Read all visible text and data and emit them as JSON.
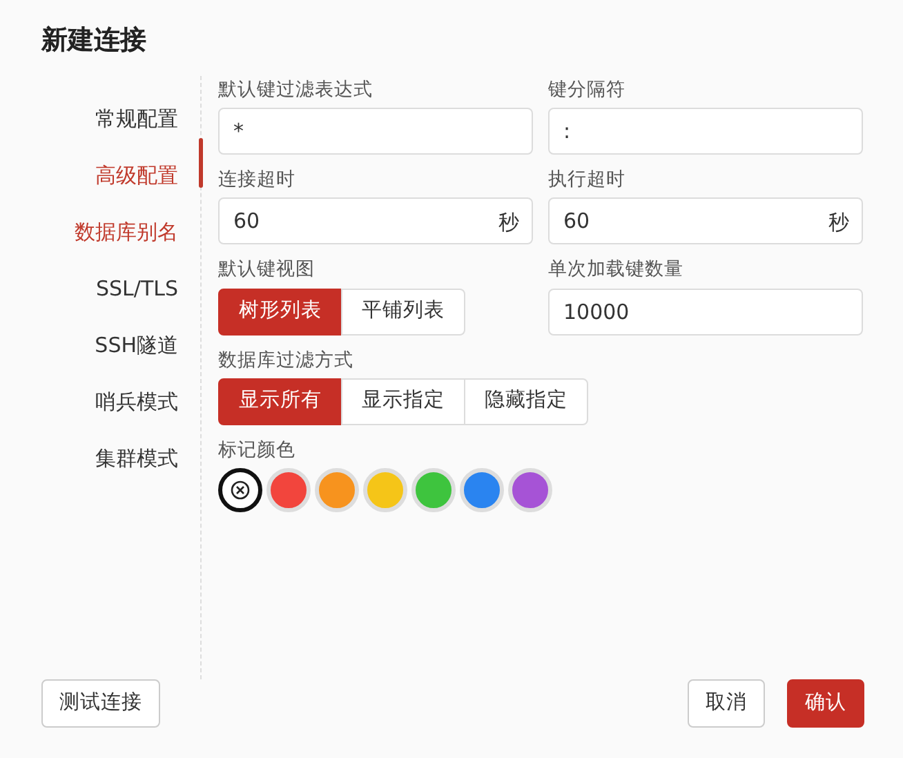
{
  "dialog": {
    "title": "新建连接"
  },
  "sidebar": {
    "items": [
      {
        "label": "常规配置",
        "selected": false,
        "hovered": false
      },
      {
        "label": "高级配置",
        "selected": true,
        "hovered": false
      },
      {
        "label": "数据库别名",
        "selected": false,
        "hovered": true
      },
      {
        "label": "SSL/TLS",
        "selected": false,
        "hovered": false
      },
      {
        "label": "SSH隧道",
        "selected": false,
        "hovered": false
      },
      {
        "label": "哨兵模式",
        "selected": false,
        "hovered": false
      },
      {
        "label": "集群模式",
        "selected": false,
        "hovered": false
      }
    ]
  },
  "form": {
    "rows": [
      [
        {
          "kind": "input",
          "label": "默认键过滤表达式",
          "value": "*"
        },
        {
          "kind": "input",
          "label": "键分隔符",
          "value": ":"
        }
      ],
      [
        {
          "kind": "input",
          "label": "连接超时",
          "value": "60",
          "suffix": "秒"
        },
        {
          "kind": "input",
          "label": "执行超时",
          "value": "60",
          "suffix": "秒"
        }
      ],
      [
        {
          "kind": "segmented",
          "label": "默认键视图",
          "options": [
            {
              "label": "树形列表",
              "selected": true
            },
            {
              "label": "平铺列表",
              "selected": false
            }
          ]
        },
        {
          "kind": "input",
          "label": "单次加载键数量",
          "value": "10000"
        }
      ],
      [
        {
          "kind": "segmented",
          "label": "数据库过滤方式",
          "options": [
            {
              "label": "显示所有",
              "selected": true
            },
            {
              "label": "显示指定",
              "selected": false
            },
            {
              "label": "隐藏指定",
              "selected": false
            }
          ]
        }
      ]
    ],
    "mark_color": {
      "label": "标记颜色",
      "swatches": [
        {
          "kind": "none",
          "selected": true
        },
        {
          "kind": "color",
          "color": "#f2453d",
          "selected": false
        },
        {
          "kind": "color",
          "color": "#f7931e",
          "selected": false
        },
        {
          "kind": "color",
          "color": "#f5c518",
          "selected": false
        },
        {
          "kind": "color",
          "color": "#3ec43e",
          "selected": false
        },
        {
          "kind": "color",
          "color": "#2a84f0",
          "selected": false
        },
        {
          "kind": "color",
          "color": "#a653d6",
          "selected": false
        }
      ]
    }
  },
  "footer": {
    "left_button": "测试连接",
    "buttons": [
      {
        "label": "取消",
        "kind": "secondary"
      },
      {
        "label": "确认",
        "kind": "primary"
      }
    ]
  }
}
